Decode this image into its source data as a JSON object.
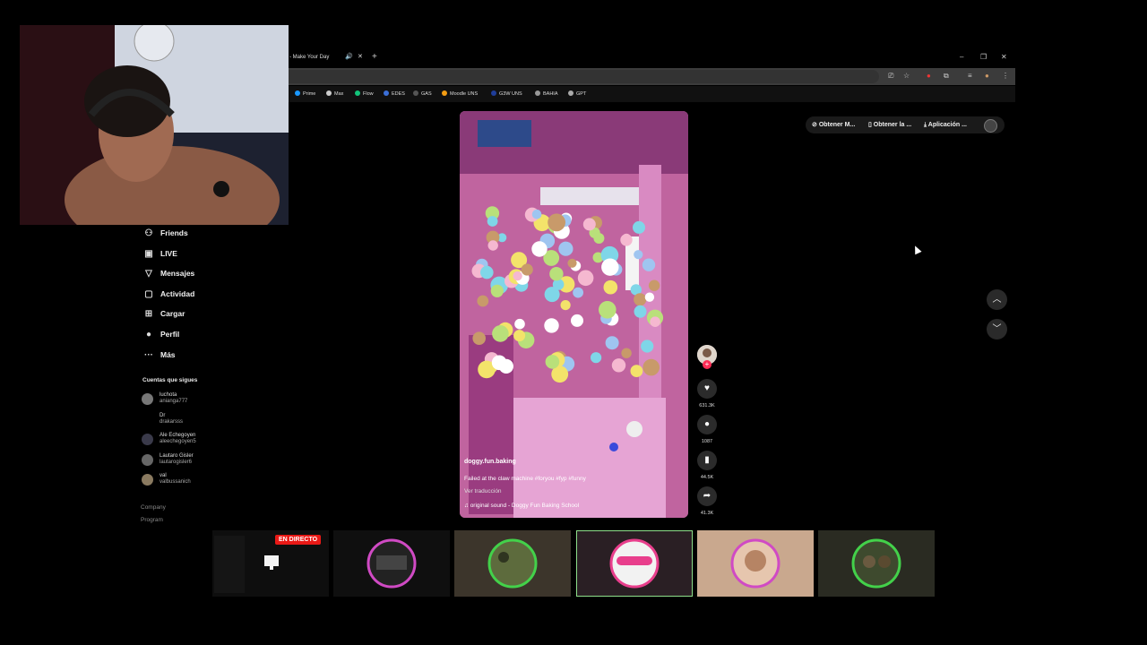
{
  "browser": {
    "tab_title": "- Make Your Day",
    "tab_audio_icon": "speaker-icon",
    "tab_close_icon": "close-icon",
    "new_tab_icon": "plus-icon",
    "window_controls": {
      "minimize": "–",
      "restore": "❐",
      "close": "✕"
    },
    "bookmarks": [
      {
        "label": "Prime",
        "color": "#1a98ff"
      },
      {
        "label": "Max",
        "color": "#cccccc"
      },
      {
        "label": "Flow",
        "color": "#12c47a"
      },
      {
        "label": "EDES",
        "color": "#3b6fd8"
      },
      {
        "label": "GAS",
        "color": "#555555"
      },
      {
        "label": "Moodle UNS",
        "color": "#f39c12"
      },
      {
        "label": "G3W UNS",
        "color": "#1f3d99"
      },
      {
        "label": "BAHIA",
        "color": "#999999"
      },
      {
        "label": "GPT",
        "color": "#aaaaaa"
      }
    ]
  },
  "sidebar": {
    "items": [
      {
        "label": "Friends",
        "icon": "friends-icon",
        "glyph": "⚇"
      },
      {
        "label": "LIVE",
        "icon": "live-icon",
        "glyph": "▣"
      },
      {
        "label": "Mensajes",
        "icon": "messages-icon",
        "glyph": "▽"
      },
      {
        "label": "Actividad",
        "icon": "activity-icon",
        "glyph": "▢"
      },
      {
        "label": "Cargar",
        "icon": "upload-icon",
        "glyph": "⊞"
      },
      {
        "label": "Perfil",
        "icon": "profile-icon",
        "glyph": "●"
      },
      {
        "label": "Más",
        "icon": "more-icon",
        "glyph": "···"
      }
    ],
    "following_title": "Cuentas que sigues",
    "accounts": [
      {
        "name": "luchota",
        "handle": "anianga777"
      },
      {
        "name": "Dr",
        "handle": "drakarsss"
      },
      {
        "name": "Ale Echegoyen",
        "handle": "aleechegoyen5"
      },
      {
        "name": "Lautaro Gisler",
        "handle": "lautarogisler6"
      },
      {
        "name": "val",
        "handle": "valbussanich"
      }
    ],
    "footer": [
      "Company",
      "Program"
    ]
  },
  "video": {
    "username": "doggy.fun.baking",
    "description": "Failed at the claw machine #foryou #fyp #funny",
    "translate": "Ver traducción",
    "sound": "original sound - Doggy Fun Baking School",
    "likes": "631.3K",
    "comments": "1087",
    "saves": "44.5K",
    "shares": "41.3K"
  },
  "top_actions": [
    "Obtener M...",
    "Obtener la ...",
    "Aplicación ..."
  ],
  "live_badge": "EN DIRECTO",
  "colors": {
    "accent": "#fe2c55",
    "live": "#e91916"
  }
}
